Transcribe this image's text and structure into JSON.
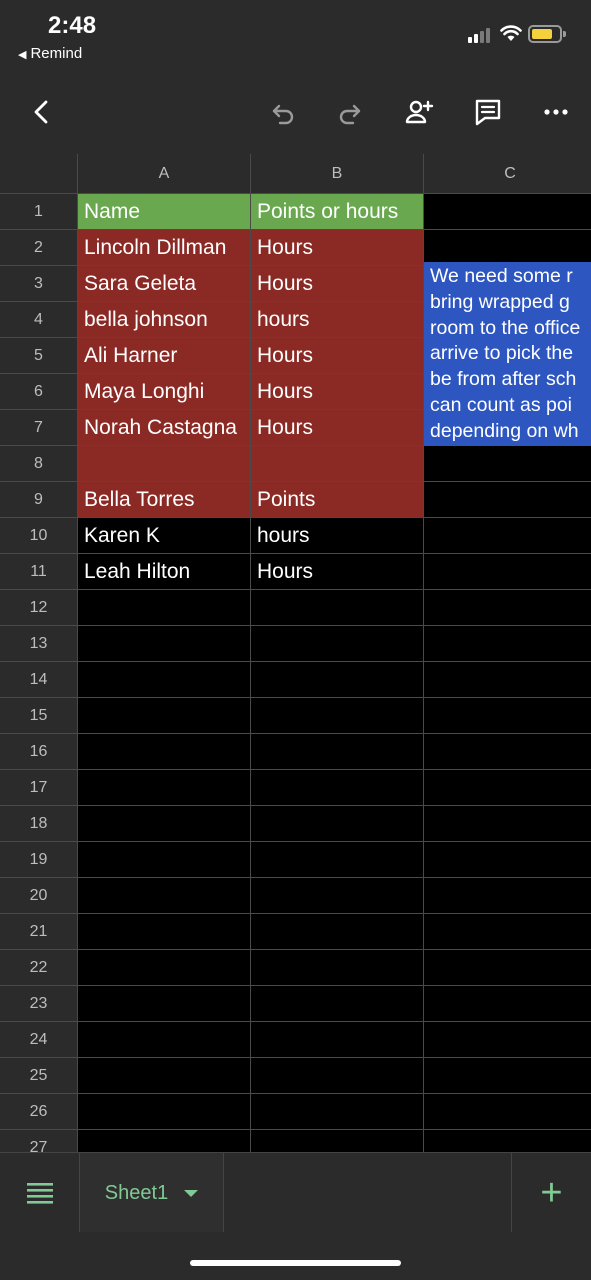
{
  "status_bar": {
    "time": "2:48",
    "back_app": "Remind",
    "battery_level": 0.75,
    "battery_color": "#f5d23c"
  },
  "toolbar": {
    "icons": [
      "back-chevron-icon",
      "undo-icon",
      "redo-icon",
      "share-add-person-icon",
      "comment-icon",
      "more-icon"
    ]
  },
  "columns": [
    "A",
    "B",
    "C"
  ],
  "rows": [
    {
      "num": "1",
      "a": "Name",
      "b": "Points or hours",
      "c": "",
      "fill": "green"
    },
    {
      "num": "2",
      "a": "Lincoln Dillman",
      "b": "Hours",
      "c": "",
      "fill": "red"
    },
    {
      "num": "3",
      "a": "Sara Geleta",
      "b": "Hours",
      "c": "",
      "fill": "red"
    },
    {
      "num": "4",
      "a": " bella johnson",
      "b": "hours",
      "c": "",
      "fill": "red"
    },
    {
      "num": "5",
      "a": "Ali Harner",
      "b": "Hours",
      "c": "",
      "fill": "red"
    },
    {
      "num": "6",
      "a": "Maya Longhi",
      "b": "Hours",
      "c": "",
      "fill": "red"
    },
    {
      "num": "7",
      "a": "Norah Castagna",
      "b": "Hours",
      "c": "",
      "fill": "red"
    },
    {
      "num": "8",
      "a": "",
      "b": "",
      "c": "",
      "fill": "red"
    },
    {
      "num": "9",
      "a": "Bella Torres",
      "b": "Points",
      "c": "",
      "fill": "red"
    },
    {
      "num": "10",
      "a": "Karen K",
      "b": "hours",
      "c": "",
      "fill": "none"
    },
    {
      "num": "11",
      "a": "Leah Hilton",
      "b": "Hours",
      "c": "",
      "fill": "none"
    },
    {
      "num": "12",
      "a": "",
      "b": "",
      "c": "",
      "fill": "none"
    },
    {
      "num": "13",
      "a": "",
      "b": "",
      "c": "",
      "fill": "none"
    },
    {
      "num": "14",
      "a": "",
      "b": "",
      "c": "",
      "fill": "none"
    },
    {
      "num": "15",
      "a": "",
      "b": "",
      "c": "",
      "fill": "none"
    },
    {
      "num": "16",
      "a": "",
      "b": "",
      "c": "",
      "fill": "none"
    },
    {
      "num": "17",
      "a": "",
      "b": "",
      "c": "",
      "fill": "none"
    },
    {
      "num": "18",
      "a": "",
      "b": "",
      "c": "",
      "fill": "none"
    },
    {
      "num": "19",
      "a": "",
      "b": "",
      "c": "",
      "fill": "none"
    },
    {
      "num": "20",
      "a": "",
      "b": "",
      "c": "",
      "fill": "none"
    },
    {
      "num": "21",
      "a": "",
      "b": "",
      "c": "",
      "fill": "none"
    },
    {
      "num": "22",
      "a": "",
      "b": "",
      "c": "",
      "fill": "none"
    },
    {
      "num": "23",
      "a": "",
      "b": "",
      "c": "",
      "fill": "none"
    },
    {
      "num": "24",
      "a": "",
      "b": "",
      "c": "",
      "fill": "none"
    },
    {
      "num": "25",
      "a": "",
      "b": "",
      "c": "",
      "fill": "none"
    },
    {
      "num": "26",
      "a": "",
      "b": "",
      "c": "",
      "fill": "none"
    },
    {
      "num": "27",
      "a": "",
      "b": "",
      "c": "",
      "fill": "none"
    }
  ],
  "note": {
    "lines": [
      "We need some r",
      "bring wrapped g",
      "room to the office",
      "arrive to pick the",
      "be from after sch",
      "can count as poi",
      "depending on wh"
    ]
  },
  "colors": {
    "header_green": "#6aa84f",
    "row_red": "#8b2a25",
    "note_blue": "#2d56c0",
    "accent_green": "#81c995"
  },
  "bottom_bar": {
    "sheet_tab": "Sheet1",
    "add_label": "+"
  }
}
